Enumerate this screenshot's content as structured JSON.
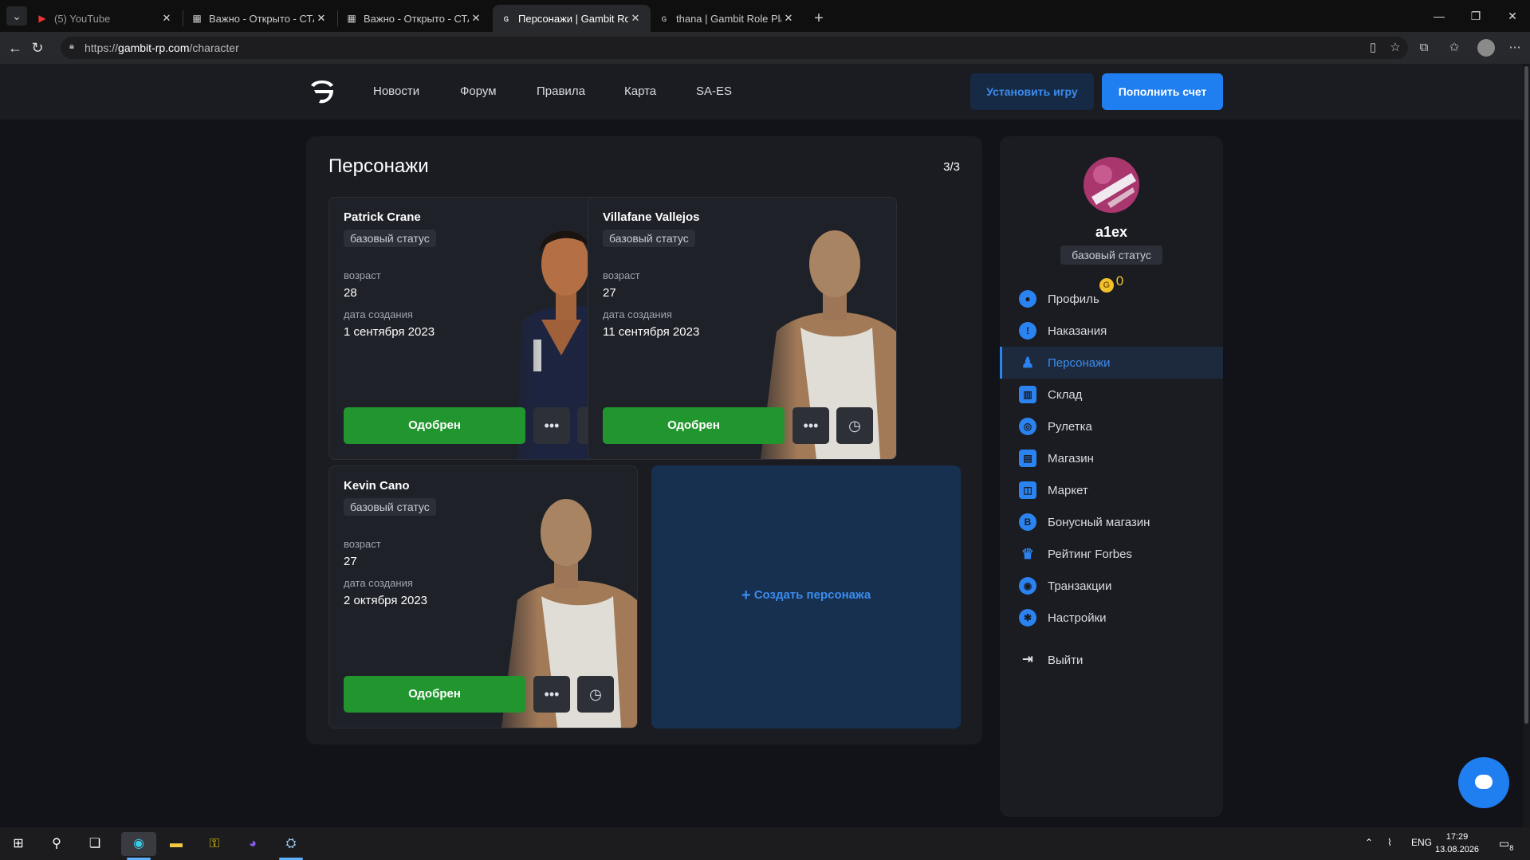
{
  "browser": {
    "tabs": [
      {
        "title": "(5) YouTube",
        "favicon": "youtube-icon"
      },
      {
        "title": "Важно - Открыто - СТАРТОВЫЙ ...",
        "favicon": "forum-icon"
      },
      {
        "title": "Важно - Открыто - СТАРТОВЫЙ ...",
        "favicon": "forum-icon"
      },
      {
        "title": "Персонажи | Gambit Role Play",
        "favicon": "gambit-icon"
      },
      {
        "title": "thana | Gambit Role Play - Форум",
        "favicon": "gambit-icon"
      }
    ],
    "url_prefix": "https://",
    "url_host": "gambit-rp.com",
    "url_path": "/character"
  },
  "header": {
    "nav": [
      "Новости",
      "Форум",
      "Правила",
      "Карта",
      "SA-ES"
    ],
    "install_label": "Установить игру",
    "topup_label": "Пополнить счет"
  },
  "characters_panel": {
    "title": "Персонажи",
    "count": "3/3",
    "age_label": "возраст",
    "created_label": "дата создания",
    "create_label": "Создать персонажа",
    "characters": [
      {
        "name": "Patrick Crane",
        "status": "базовый статус",
        "age": "28",
        "created": "1 сентября 2023",
        "approved_label": "Одобрен",
        "skin": "dark-uniform"
      },
      {
        "name": "Villafane Vallejos",
        "status": "базовый статус",
        "age": "27",
        "created": "11 сентября 2023",
        "approved_label": "Одобрен",
        "skin": "white-tank"
      },
      {
        "name": "Kevin Cano",
        "status": "базовый статус",
        "age": "27",
        "created": "2 октября 2023",
        "approved_label": "Одобрен",
        "skin": "white-tank"
      }
    ]
  },
  "sidebar": {
    "username": "a1ex",
    "status": "базовый статус",
    "coins": "0",
    "coin_symbol": "G",
    "items": [
      {
        "label": "Профиль",
        "icon": "user-icon",
        "glyph": "●"
      },
      {
        "label": "Наказания",
        "icon": "warning-icon",
        "glyph": "!"
      },
      {
        "label": "Персонажи",
        "icon": "person-icon",
        "glyph": "♟",
        "active": true
      },
      {
        "label": "Склад",
        "icon": "warehouse-icon",
        "glyph": "▥"
      },
      {
        "label": "Рулетка",
        "icon": "roulette-icon",
        "glyph": "◎"
      },
      {
        "label": "Магазин",
        "icon": "store-icon",
        "glyph": "▤"
      },
      {
        "label": "Маркет",
        "icon": "bag-icon",
        "glyph": "◫"
      },
      {
        "label": "Бонусный магазин",
        "icon": "bonus-icon",
        "glyph": "B"
      },
      {
        "label": "Рейтинг Forbes",
        "icon": "trophy-icon",
        "glyph": "♛"
      },
      {
        "label": "Транзакции",
        "icon": "transactions-icon",
        "glyph": "◉"
      },
      {
        "label": "Настройки",
        "icon": "settings-icon",
        "glyph": "✱"
      }
    ],
    "logout_label": "Выйти"
  },
  "taskbar": {
    "lang": "ENG",
    "time": "17:29",
    "date": "13.08.2026",
    "notifications": "8"
  },
  "colors": {
    "accent": "#1f7ef0",
    "approved": "#22962e",
    "panel": "#1a1c22",
    "background": "#111318"
  }
}
